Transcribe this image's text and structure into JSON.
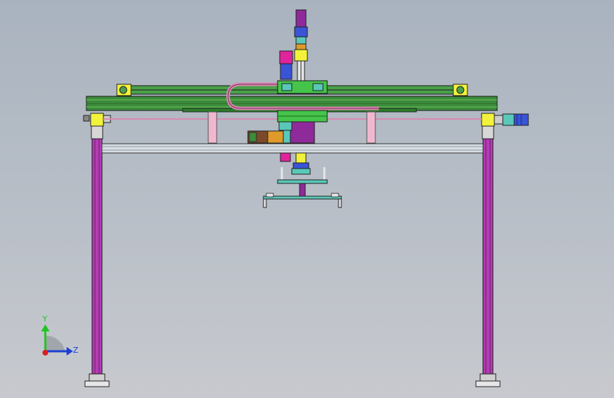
{
  "triad": {
    "y_label": "Y",
    "z_label": "Z",
    "y_color": "#22c422",
    "z_color": "#1a3fd6",
    "origin_color": "#d81e1e"
  },
  "colors": {
    "background": "#b3bbc5",
    "column": "#b33cb3",
    "column_edge": "#1a1a1a",
    "beam": "#3c8c3c",
    "beam_light": "#6fbf5a",
    "bracket": "#f2f23a",
    "rail": "#d8dde2",
    "cable_chain": "#d98ab0",
    "carriage": "#44c44a",
    "motor_magenta": "#e0249c",
    "motor_blue": "#3a54d6",
    "motor_brown": "#7a4a2a",
    "motor_orange": "#e09a2a",
    "purple": "#8e2a9a",
    "teal": "#5ac8b8",
    "pink_post": "#f0b8d0"
  }
}
